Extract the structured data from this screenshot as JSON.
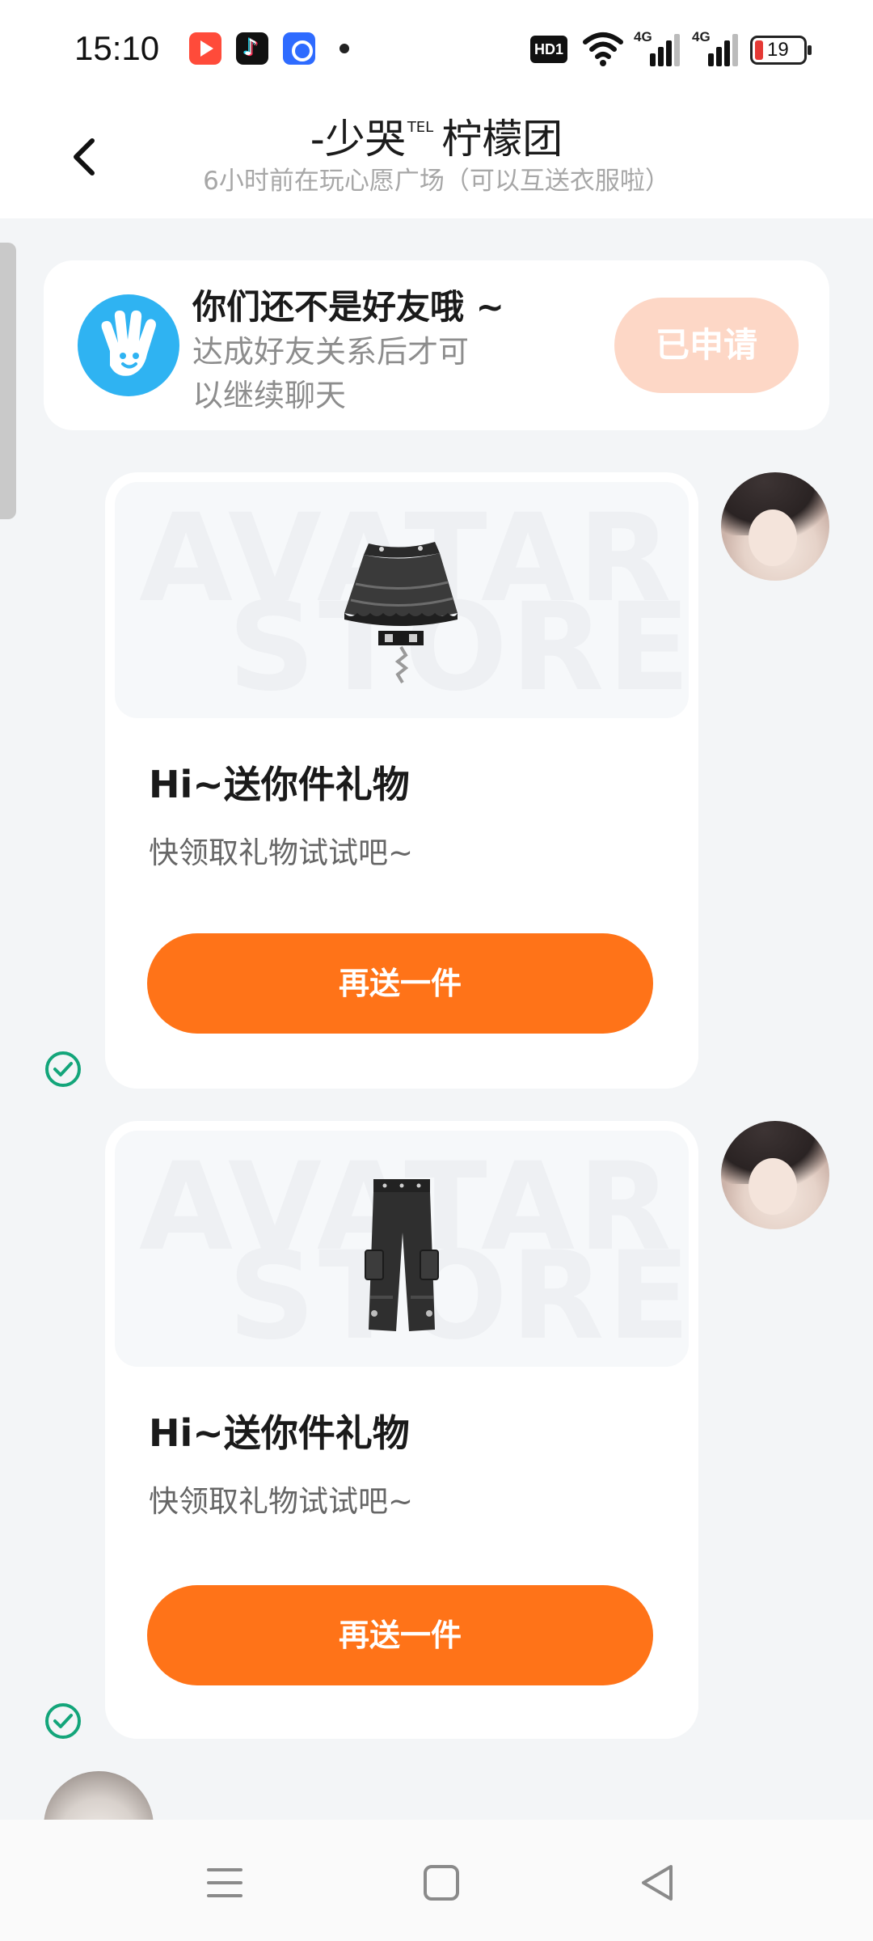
{
  "status_bar": {
    "time": "15:10",
    "network_badge": "HD1",
    "signal_1_label": "4G",
    "signal_2_label": "4G",
    "battery_level": "19",
    "battery_color": "#e53935",
    "app_icons": [
      "video-app-icon",
      "tiktok-app-icon",
      "baidu-app-icon"
    ]
  },
  "header": {
    "title_prefix": "-少哭",
    "title_sup": "TEL",
    "title_suffix": "柠檬团",
    "subtitle": "6小时前在玩心愿广场（可以互送衣服啦）",
    "back_icon": "chevron-left-icon"
  },
  "friend_notice": {
    "icon": "waving-hand-icon",
    "title": "你们还不是好友哦 ~",
    "description": "达成好友关系后才可以继续聊天",
    "button_label": "已申请",
    "button_color": "#fdd7c6"
  },
  "messages": [
    {
      "item": "skirt",
      "watermark_line1": "AVATAR",
      "watermark_line2": "STORE",
      "title": "Hi~送你件礼物",
      "description": "快领取礼物试试吧~",
      "button_label": "再送一件",
      "status_icon": "check-circle-icon"
    },
    {
      "item": "cargo-pants",
      "watermark_line1": "AVATAR",
      "watermark_line2": "STORE",
      "title": "Hi~送你件礼物",
      "description": "快领取礼物试试吧~",
      "button_label": "再送一件",
      "status_icon": "check-circle-icon"
    }
  ],
  "colors": {
    "accent": "#ff7318",
    "read_check": "#13a57a",
    "page_bg": "#f3f5f7"
  },
  "nav_bar": {
    "icons": [
      "menu-icon",
      "home-square-icon",
      "back-triangle-icon"
    ]
  }
}
